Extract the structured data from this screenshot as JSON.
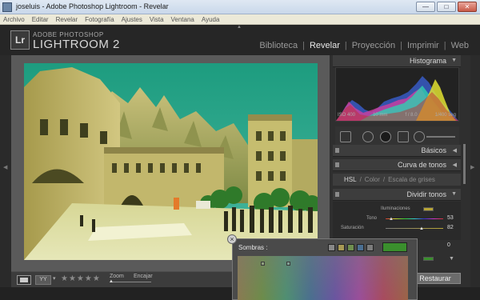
{
  "window": {
    "title": "joseluis - Adobe Photoshop Lightroom - Revelar",
    "minimize": "—",
    "maximize": "□",
    "close": "✕"
  },
  "menu": [
    "Archivo",
    "Editar",
    "Revelar",
    "Fotografía",
    "Ajustes",
    "Vista",
    "Ventana",
    "Ayuda"
  ],
  "logo": {
    "badge": "Lr",
    "small": "ADOBE PHOTOSHOP",
    "big": "LIGHTROOM 2"
  },
  "modules": [
    {
      "label": "Biblioteca",
      "active": false
    },
    {
      "label": "Revelar",
      "active": true
    },
    {
      "label": "Proyección",
      "active": false
    },
    {
      "label": "Imprimir",
      "active": false
    },
    {
      "label": "Web",
      "active": false
    }
  ],
  "toolbar": {
    "yy": "YY",
    "stars": "★★★★★",
    "zoom_label": "Zoom",
    "fit_label": "Encajar",
    "zoom_level": 0
  },
  "panels": {
    "histogram": {
      "title": "Histograma",
      "iso": "ISO 400",
      "focal": "10 mm",
      "aperture": "f / 8.0",
      "shutter": "1/400 seg"
    },
    "basic": "Básicos",
    "tone_curve": "Curva de tonos",
    "hsl": {
      "hsl": "HSL",
      "sep1": "/",
      "color": "Color",
      "sep2": "/",
      "gray": "Escala de grises"
    },
    "split": {
      "title": "Dividir tonos",
      "highlights_label": "Iluminaciones",
      "highlights_color": "#b8a536",
      "hue_label": "Tono",
      "hue_value": "53",
      "saturation_label": "Saturación",
      "saturation_value": "82",
      "balance_value": "0"
    },
    "restore": "Restaurar"
  },
  "popup": {
    "close": "×",
    "title": "Sombras :",
    "swatches": [
      "#888888",
      "#a89a55",
      "#6f8f4f",
      "#4b6f92",
      "#7c7c7c"
    ],
    "selected_color": "#3a8f2d"
  },
  "colors": {
    "accent": "#e8e8e8",
    "panel": "#2f2f2f"
  }
}
